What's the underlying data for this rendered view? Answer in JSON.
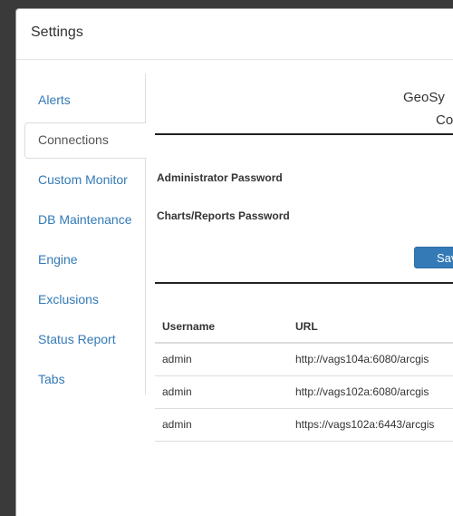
{
  "dialog": {
    "title": "Settings"
  },
  "tabs": [
    {
      "label": "Alerts"
    },
    {
      "label": "Connections"
    },
    {
      "label": "Custom Monitor"
    },
    {
      "label": "DB Maintenance"
    },
    {
      "label": "Engine"
    },
    {
      "label": "Exclusions"
    },
    {
      "label": "Status Report"
    },
    {
      "label": "Tabs"
    }
  ],
  "active_tab": "Connections",
  "header": {
    "brand_line1": "GeoSy",
    "brand_line2": "Co"
  },
  "form": {
    "admin_password_label": "Administrator Password",
    "charts_password_label": "Charts/Reports Password",
    "save_label": "Save"
  },
  "table": {
    "columns": [
      "Username",
      "URL"
    ],
    "rows": [
      {
        "username": "admin",
        "url": "http://vags104a:6080/arcgis"
      },
      {
        "username": "admin",
        "url": "http://vags102a:6080/arcgis"
      },
      {
        "username": "admin",
        "url": "https://vags102a:6443/arcgis"
      }
    ]
  },
  "colors": {
    "link": "#337ab7",
    "primary_button": "#337ab7"
  }
}
